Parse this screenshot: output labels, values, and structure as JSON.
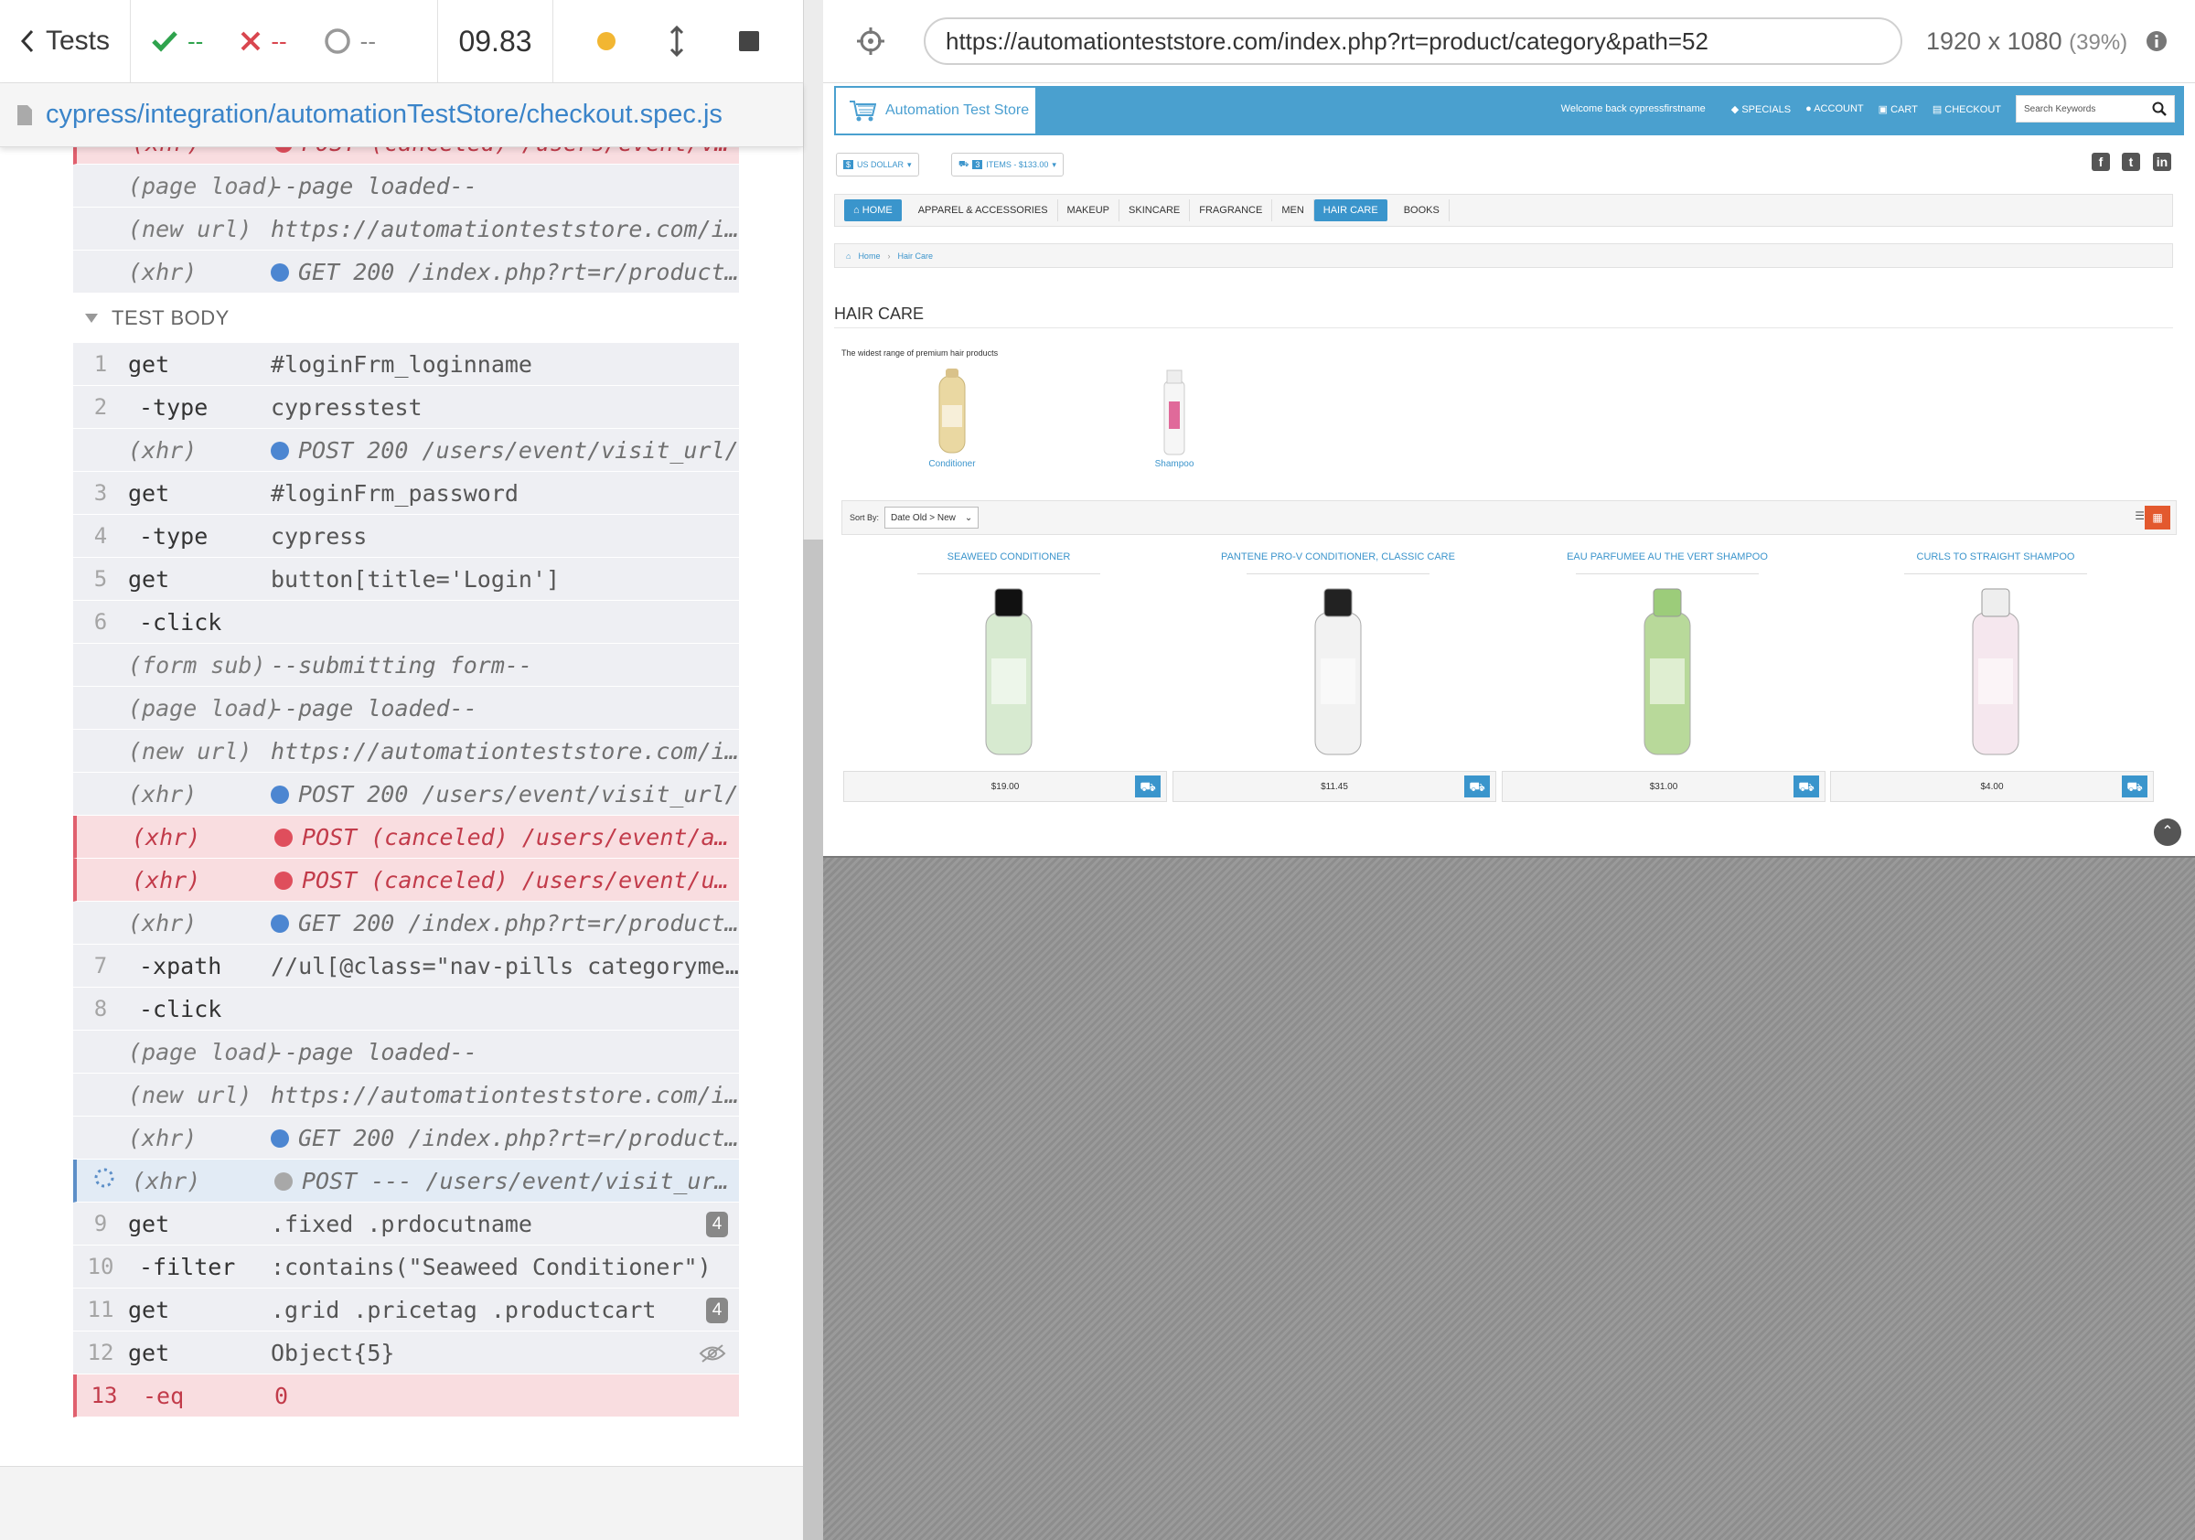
{
  "runner": {
    "tests_label": "Tests",
    "passed": "--",
    "failed": "--",
    "pending": "--",
    "duration": "09.83",
    "spec_path": "cypress/integration/automationTestStore/checkout.spec.js",
    "hook_title": "TEST BODY"
  },
  "log": {
    "pre_rows": [
      {
        "cmd": "(xhr)",
        "state": "failed",
        "dot": "red",
        "msg": "POST (canceled) /users/event/vi..."
      },
      {
        "cmd": "(page load)",
        "state": "event",
        "dot": "",
        "msg": "--page loaded--"
      },
      {
        "cmd": "(new url)",
        "state": "event",
        "dot": "",
        "msg": "https://automationteststore.com/i..."
      },
      {
        "cmd": "(xhr)",
        "state": "event",
        "dot": "blue",
        "msg": "GET 200 /index.php?rt=r/product..."
      }
    ],
    "rows": [
      {
        "num": "1",
        "cmd": "get",
        "type": "parent",
        "state": "",
        "dot": "",
        "msg": "#loginFrm_loginname"
      },
      {
        "num": "2",
        "cmd": "-type",
        "type": "child",
        "state": "",
        "dot": "",
        "msg": "cypresstest"
      },
      {
        "num": "",
        "cmd": "(xhr)",
        "type": "event",
        "state": "event",
        "dot": "blue",
        "msg": "POST 200 /users/event/visit_url/"
      },
      {
        "num": "3",
        "cmd": "get",
        "type": "parent",
        "state": "",
        "dot": "",
        "msg": "#loginFrm_password"
      },
      {
        "num": "4",
        "cmd": "-type",
        "type": "child",
        "state": "",
        "dot": "",
        "msg": "cypress"
      },
      {
        "num": "5",
        "cmd": "get",
        "type": "parent",
        "state": "",
        "dot": "",
        "msg": "button[title='Login']"
      },
      {
        "num": "6",
        "cmd": "-click",
        "type": "child",
        "state": "",
        "dot": "",
        "msg": ""
      },
      {
        "num": "",
        "cmd": "(form sub)",
        "type": "event",
        "state": "event",
        "dot": "",
        "msg": "--submitting form--"
      },
      {
        "num": "",
        "cmd": "(page load)",
        "type": "event",
        "state": "event",
        "dot": "",
        "msg": "--page loaded--"
      },
      {
        "num": "",
        "cmd": "(new url)",
        "type": "event",
        "state": "event",
        "dot": "",
        "msg": "https://automationteststore.com/i..."
      },
      {
        "num": "",
        "cmd": "(xhr)",
        "type": "event",
        "state": "event",
        "dot": "blue",
        "msg": "POST 200 /users/event/visit_url/"
      },
      {
        "num": "",
        "cmd": "(xhr)",
        "type": "event",
        "state": "failed",
        "dot": "red",
        "msg": "POST (canceled) /users/event/ad..."
      },
      {
        "num": "",
        "cmd": "(xhr)",
        "type": "event",
        "state": "failed",
        "dot": "red",
        "msg": "POST (canceled) /users/event/up..."
      },
      {
        "num": "",
        "cmd": "(xhr)",
        "type": "event",
        "state": "event",
        "dot": "blue",
        "msg": "GET 200 /index.php?rt=r/product..."
      },
      {
        "num": "7",
        "cmd": "-xpath",
        "type": "child",
        "state": "",
        "dot": "",
        "msg": "//ul[@class=\"nav-pills categoryme..."
      },
      {
        "num": "8",
        "cmd": "-click",
        "type": "child",
        "state": "",
        "dot": "",
        "msg": ""
      },
      {
        "num": "",
        "cmd": "(page load)",
        "type": "event",
        "state": "event",
        "dot": "",
        "msg": "--page loaded--"
      },
      {
        "num": "",
        "cmd": "(new url)",
        "type": "event",
        "state": "event",
        "dot": "",
        "msg": "https://automationteststore.com/i..."
      },
      {
        "num": "",
        "cmd": "(xhr)",
        "type": "event",
        "state": "event",
        "dot": "blue",
        "msg": "GET 200 /index.php?rt=r/product..."
      },
      {
        "num": "",
        "cmd": "(xhr)",
        "type": "event",
        "state": "pending",
        "dot": "gray",
        "msg": "POST --- /users/event/visit_url/"
      },
      {
        "num": "9",
        "cmd": "get",
        "type": "parent",
        "state": "",
        "dot": "",
        "msg": ".fixed .prdocutname",
        "badge": "4"
      },
      {
        "num": "10",
        "cmd": "-filter",
        "type": "child",
        "state": "",
        "dot": "",
        "msg": ":contains(\"Seaweed Conditioner\")"
      },
      {
        "num": "11",
        "cmd": "get",
        "type": "parent",
        "state": "",
        "dot": "",
        "msg": ".grid .pricetag .productcart",
        "badge": "4"
      },
      {
        "num": "12",
        "cmd": "get",
        "type": "parent",
        "state": "",
        "dot": "",
        "msg": "Object{5}",
        "eye": true
      },
      {
        "num": "13",
        "cmd": "-eq",
        "type": "child",
        "state": "failed",
        "dot": "",
        "msg": "0"
      }
    ]
  },
  "aut": {
    "url": "https://automationteststore.com/index.php?rt=product/category&path=52",
    "viewport": "1920 x 1080",
    "zoom": "(39%)"
  },
  "store": {
    "logo_text": "Automation Test Store",
    "welcome": "Welcome back cypressfirstname",
    "specials": "SPECIALS",
    "account": "ACCOUNT",
    "cart": "CART",
    "checkout": "CHECKOUT",
    "search_placeholder": "Search Keywords",
    "currency": "US DOLLAR",
    "currency_symbol": "$",
    "items_count": "3",
    "items_label": "ITEMS - $133.00",
    "menu": [
      "HOME",
      "APPAREL & ACCESSORIES",
      "MAKEUP",
      "SKINCARE",
      "FRAGRANCE",
      "MEN",
      "HAIR CARE",
      "BOOKS"
    ],
    "breadcrumb_home": "Home",
    "breadcrumb_current": "Hair Care",
    "heading": "HAIR CARE",
    "description": "The widest range of premium hair products",
    "subcategories": [
      "Conditioner",
      "Shampoo"
    ],
    "sort_label": "Sort By:",
    "sort_value": "Date Old > New",
    "products": [
      {
        "name": "SEAWEED CONDITIONER",
        "price": "$19.00",
        "color": "#d7ead0",
        "cap": "#111"
      },
      {
        "name": "PANTENE PRO-V CONDITIONER, CLASSIC CARE",
        "price": "$11.45",
        "color": "#f2f2f2",
        "cap": "#222"
      },
      {
        "name": "EAU PARFUMEE AU THE VERT SHAMPOO",
        "price": "$31.00",
        "color": "#b8d99a",
        "cap": "#9ccc7a"
      },
      {
        "name": "CURLS TO STRAIGHT SHAMPOO",
        "price": "$4.00",
        "color": "#f5e7ee",
        "cap": "#eee"
      }
    ]
  }
}
